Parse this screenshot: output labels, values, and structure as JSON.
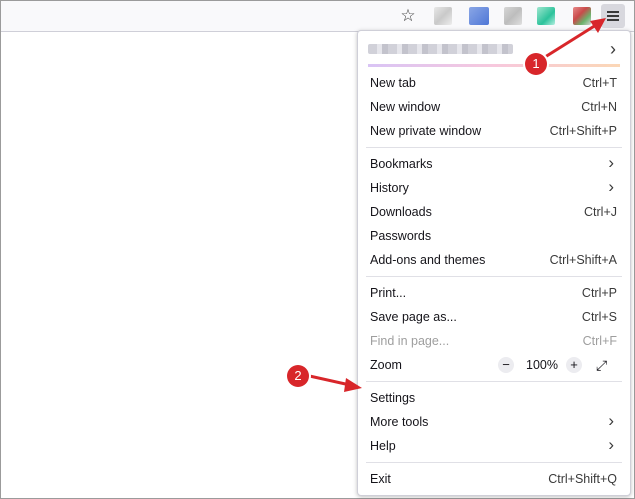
{
  "toolbar": {
    "icons": [
      "bookmark-star-icon",
      "extension-icon",
      "extension-icon",
      "extension-icon",
      "extension-icon",
      "extension-icon",
      "hamburger-menu-icon"
    ]
  },
  "menu": {
    "account_chevron": "›",
    "groups": [
      [
        {
          "label": "New tab",
          "shortcut": "Ctrl+T"
        },
        {
          "label": "New window",
          "shortcut": "Ctrl+N"
        },
        {
          "label": "New private window",
          "shortcut": "Ctrl+Shift+P"
        }
      ],
      [
        {
          "label": "Bookmarks",
          "submenu": true
        },
        {
          "label": "History",
          "submenu": true
        },
        {
          "label": "Downloads",
          "shortcut": "Ctrl+J"
        },
        {
          "label": "Passwords"
        },
        {
          "label": "Add-ons and themes",
          "shortcut": "Ctrl+Shift+A"
        }
      ],
      [
        {
          "label": "Print...",
          "shortcut": "Ctrl+P"
        },
        {
          "label": "Save page as...",
          "shortcut": "Ctrl+S"
        },
        {
          "label": "Find in page...",
          "shortcut": "Ctrl+F",
          "disabled": true
        }
      ]
    ],
    "zoom": {
      "label": "Zoom",
      "minus": "−",
      "value": "100%",
      "plus": "+",
      "fullscreen": "⤢"
    },
    "items_after_zoom": [
      {
        "label": "Settings"
      },
      {
        "label": "More tools",
        "submenu": true
      },
      {
        "label": "Help",
        "submenu": true
      }
    ],
    "exit": {
      "label": "Exit",
      "shortcut": "Ctrl+Shift+Q"
    }
  },
  "annotations": {
    "badge1": "1",
    "badge2": "2",
    "color": "#d8262a"
  }
}
